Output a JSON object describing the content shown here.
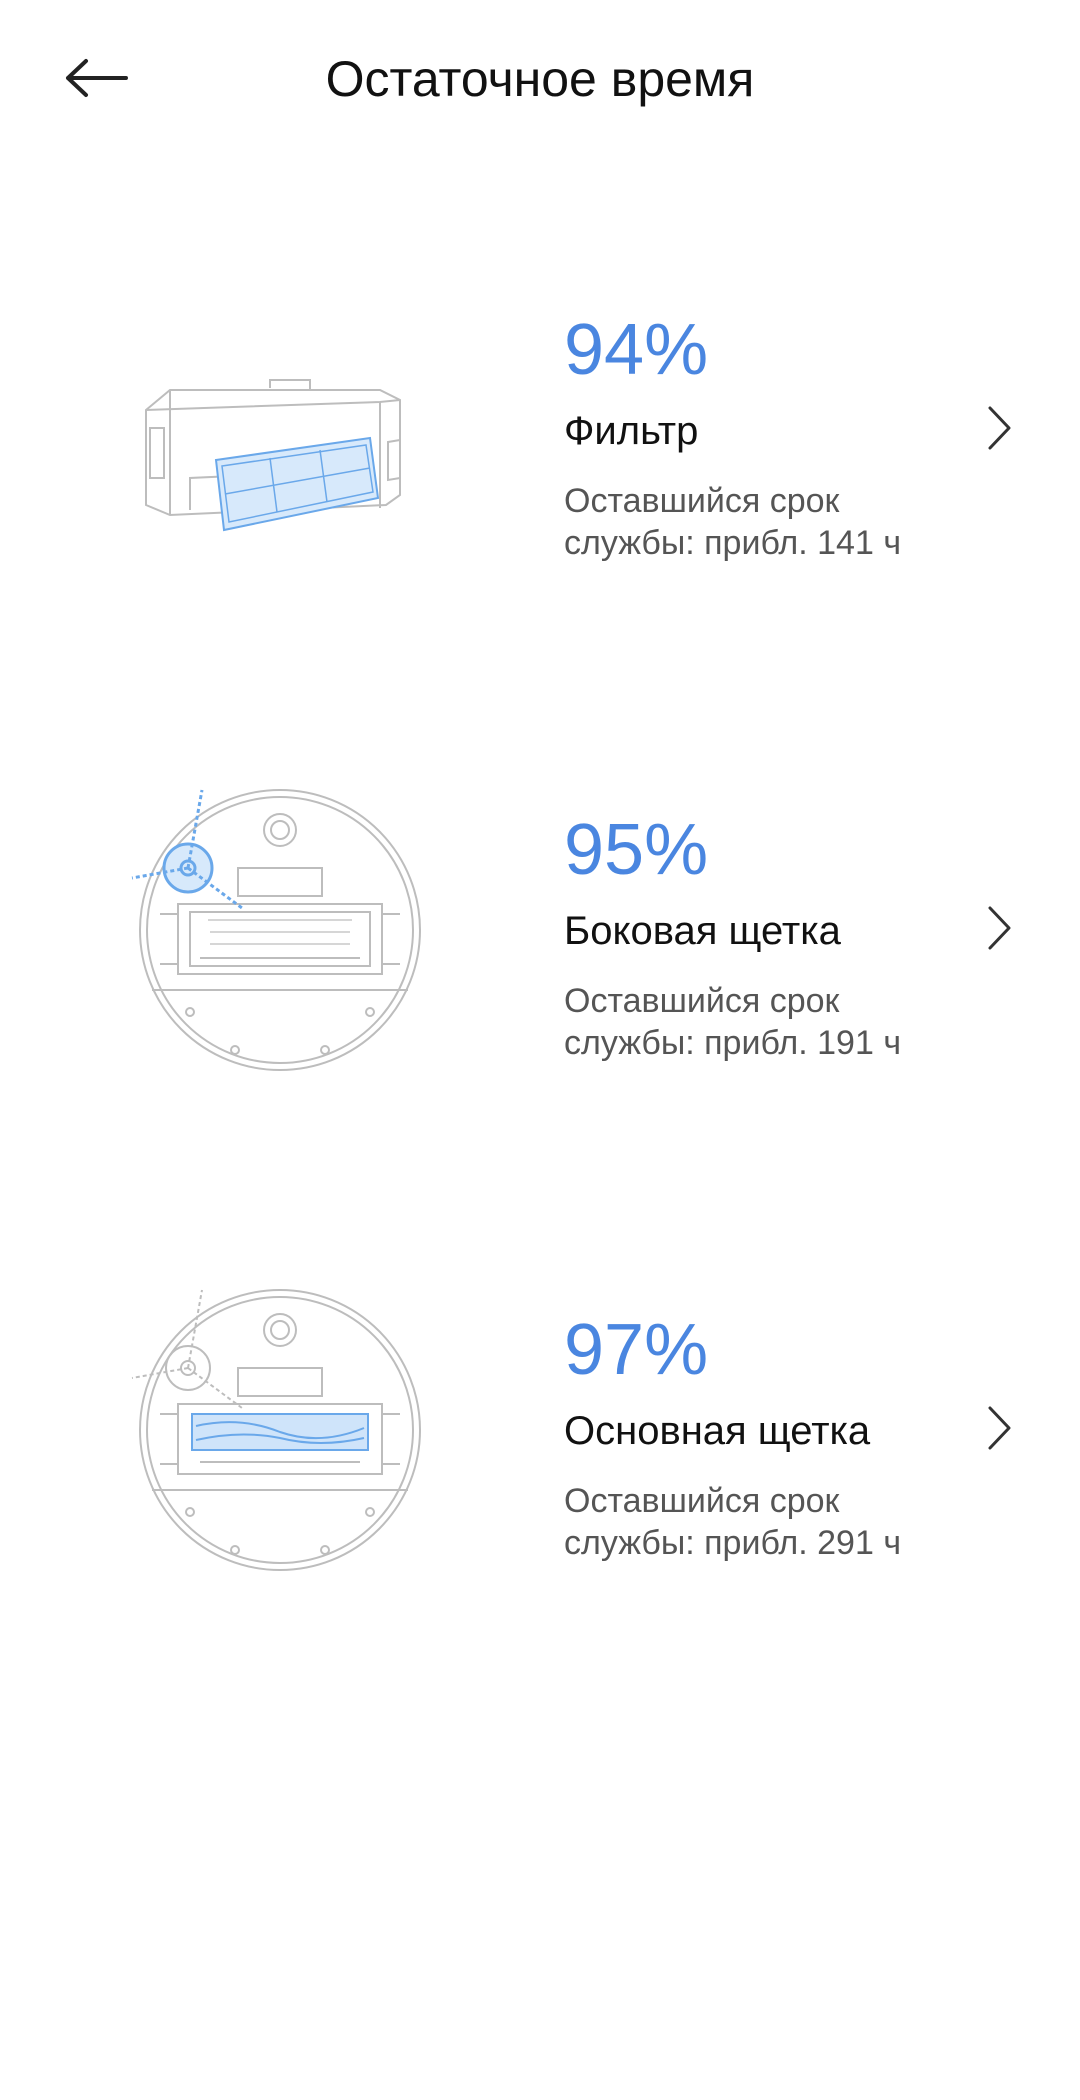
{
  "header": {
    "title": "Остаточное время"
  },
  "items": [
    {
      "percent": "94%",
      "name": "Фильтр",
      "desc": "Оставшийся срок службы: прибл. 141 ч",
      "remaining_fraction": 0.94,
      "icon": "filter-illustration"
    },
    {
      "percent": "95%",
      "name": "Боковая щетка",
      "desc": "Оставшийся срок службы: прибл. 191 ч",
      "remaining_fraction": 0.95,
      "icon": "side-brush-illustration"
    },
    {
      "percent": "97%",
      "name": "Основная щетка",
      "desc": "Оставшийся срок службы: прибл. 291 ч",
      "remaining_fraction": 0.97,
      "icon": "main-brush-illustration"
    }
  ],
  "colors": {
    "accent": "#4a86e0",
    "highlight": "#7fb6ef",
    "outline": "#b9b9b9"
  }
}
